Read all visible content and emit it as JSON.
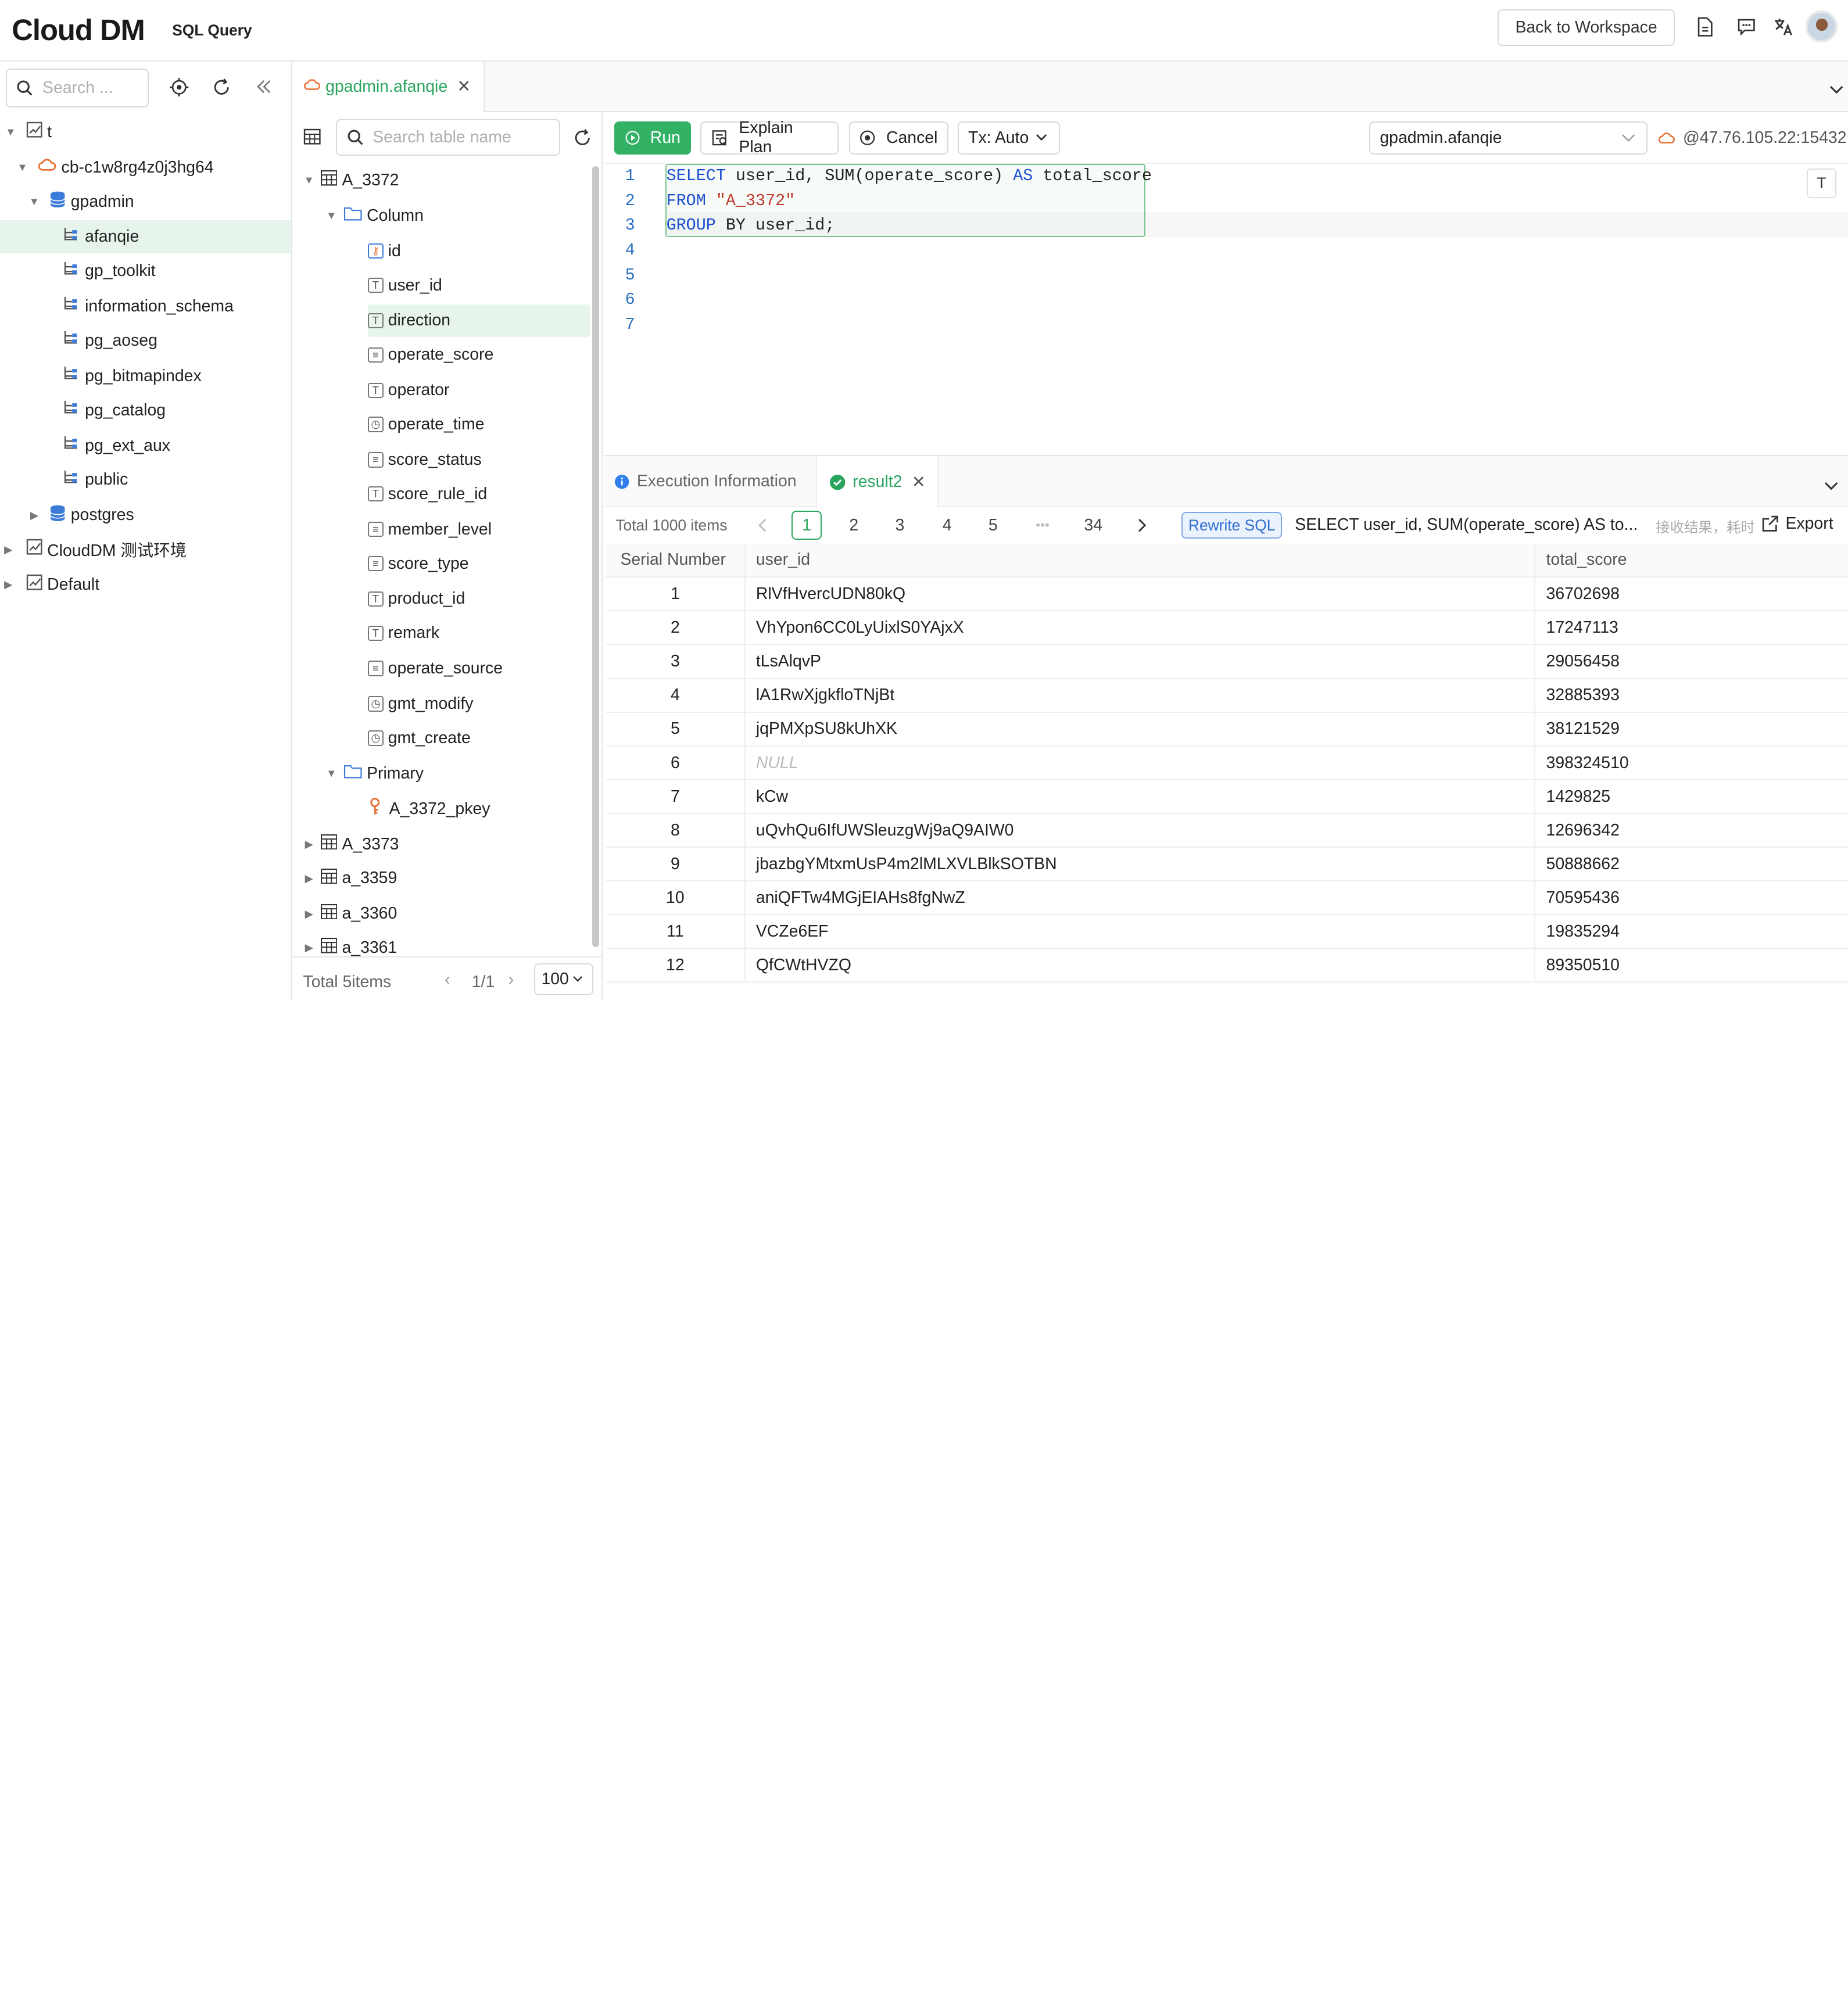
{
  "app": {
    "logo": "Cloud DM",
    "subtitle": "SQL Query",
    "back_button": "Back to Workspace"
  },
  "left_tree": {
    "search_placeholder": "Search ...",
    "nodes": [
      {
        "label": "t",
        "icon": "chart-icon"
      },
      {
        "label": "cb-c1w8rg4z0j3hg64",
        "icon": "cloud-icon"
      },
      {
        "label": "gpadmin",
        "icon": "database-icon"
      },
      {
        "label": "afanqie",
        "icon": "schema-icon"
      },
      {
        "label": "gp_toolkit",
        "icon": "schema-icon"
      },
      {
        "label": "information_schema",
        "icon": "schema-icon"
      },
      {
        "label": "pg_aoseg",
        "icon": "schema-icon"
      },
      {
        "label": "pg_bitmapindex",
        "icon": "schema-icon"
      },
      {
        "label": "pg_catalog",
        "icon": "schema-icon"
      },
      {
        "label": "pg_ext_aux",
        "icon": "schema-icon"
      },
      {
        "label": "public",
        "icon": "schema-icon"
      },
      {
        "label": "postgres",
        "icon": "database-icon"
      },
      {
        "label": "CloudDM 测试环境",
        "icon": "chart-icon"
      },
      {
        "label": "Default",
        "icon": "chart-icon"
      }
    ]
  },
  "editor_tab": {
    "label": "gpadmin.afanqie"
  },
  "table_pane": {
    "search_placeholder": "Search table name",
    "table": "A_3372",
    "column_folder": "Column",
    "columns": [
      {
        "name": "id",
        "type": "key"
      },
      {
        "name": "user_id",
        "type": "T"
      },
      {
        "name": "direction",
        "type": "T"
      },
      {
        "name": "operate_score",
        "type": "num"
      },
      {
        "name": "operator",
        "type": "T"
      },
      {
        "name": "operate_time",
        "type": "time"
      },
      {
        "name": "score_status",
        "type": "num"
      },
      {
        "name": "score_rule_id",
        "type": "T"
      },
      {
        "name": "member_level",
        "type": "num"
      },
      {
        "name": "score_type",
        "type": "num"
      },
      {
        "name": "product_id",
        "type": "T"
      },
      {
        "name": "remark",
        "type": "T"
      },
      {
        "name": "operate_source",
        "type": "num"
      },
      {
        "name": "gmt_modify",
        "type": "time"
      },
      {
        "name": "gmt_create",
        "type": "time"
      }
    ],
    "primary_folder": "Primary",
    "primary_key": "A_3372_pkey",
    "other_tables": [
      "A_3373",
      "a_3359",
      "a_3360",
      "a_3361"
    ],
    "footer": {
      "total": "Total 5items",
      "page": "1/1",
      "page_size": "100"
    }
  },
  "toolbar": {
    "run": "Run",
    "explain": "Explain Plan",
    "cancel": "Cancel",
    "tx": "Tx: Auto",
    "connection": "gpadmin.afanqie",
    "host": "@47.76.105.22:15432"
  },
  "editor": {
    "line_numbers": [
      "1",
      "2",
      "3",
      "4",
      "5",
      "6",
      "7"
    ],
    "line1_kw1": "SELECT",
    "line1_rest1": " user_id, SUM(operate_score) ",
    "line1_kw2": "AS",
    "line1_rest2": " total_score",
    "line2_kw": "FROM",
    "line2_str": "\"A_3372\"",
    "line3_kw": "GROUP",
    "line3_rest": " BY user_id;",
    "side_button": "T"
  },
  "results": {
    "tab_info": "Execution Information",
    "tab_result": "result2",
    "total": "Total 1000 items",
    "pages": [
      "1",
      "2",
      "3",
      "4",
      "5",
      "•••",
      "34"
    ],
    "rewrite": "Rewrite SQL",
    "sql_preview": "SELECT user_id, SUM(operate_score) AS to...",
    "hint": "接收结果，耗时",
    "export": "Export",
    "columns": [
      "Serial Number",
      "user_id",
      "total_score"
    ],
    "rows": [
      [
        "1",
        "RlVfHvercUDN80kQ",
        "36702698"
      ],
      [
        "2",
        "VhYpon6CC0LyUixlS0YAjxX",
        "17247113"
      ],
      [
        "3",
        "tLsAlqvP",
        "29056458"
      ],
      [
        "4",
        "lA1RwXjgkfloTNjBt",
        "32885393"
      ],
      [
        "5",
        "jqPMXpSU8kUhXK",
        "38121529"
      ],
      [
        "6",
        "NULL",
        "398324510"
      ],
      [
        "7",
        "kCw",
        "1429825"
      ],
      [
        "8",
        "uQvhQu6IfUWSleuzgWj9aQ9AIW0",
        "12696342"
      ],
      [
        "9",
        "jbazbgYMtxmUsP4m2lMLXVLBlkSOTBN",
        "50888662"
      ],
      [
        "10",
        "aniQFTw4MGjEIAHs8fgNwZ",
        "70595436"
      ],
      [
        "11",
        "VCZe6EF",
        "19835294"
      ],
      [
        "12",
        "QfCWtHVZQ",
        "89350510"
      ]
    ]
  },
  "colors": {
    "accent": "#2aa55e",
    "run": "#33b266",
    "keyword": "#1d4fd0",
    "string": "#c0392b",
    "cloud": "#e8743b",
    "database": "#3d7bd9"
  }
}
